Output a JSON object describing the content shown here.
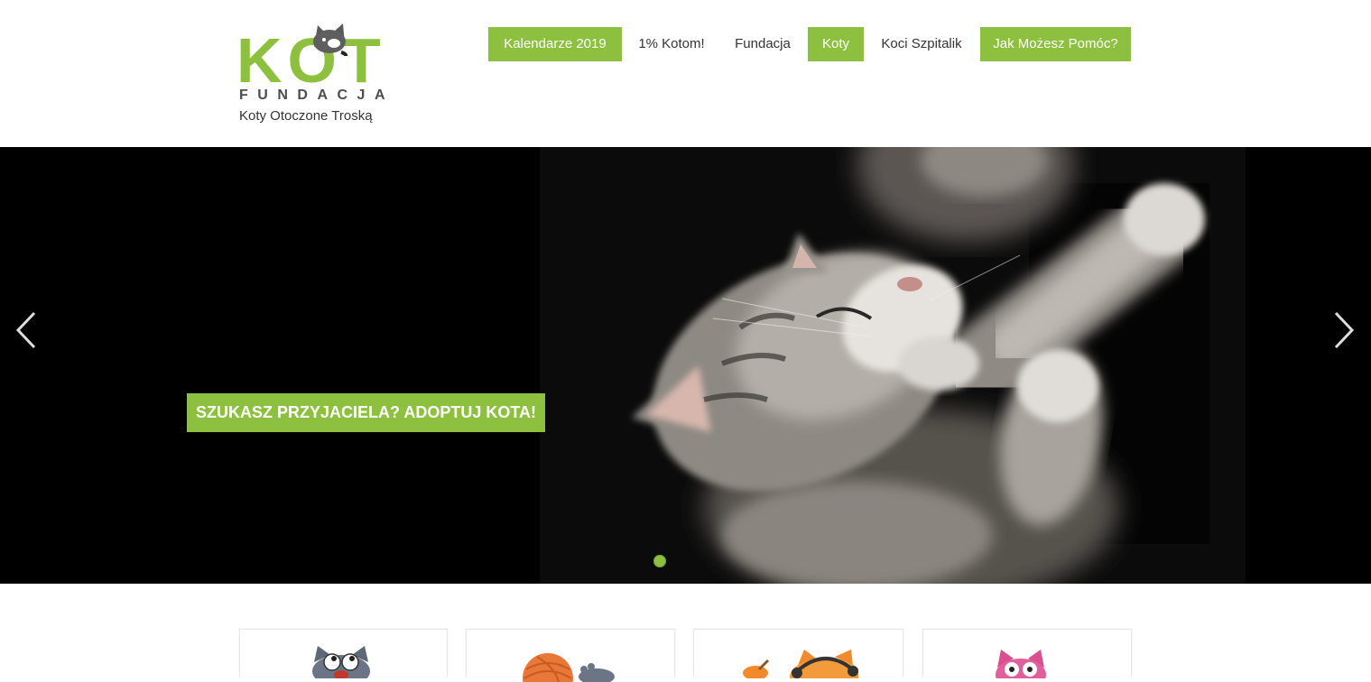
{
  "site": {
    "accent_color": "#8dc03f"
  },
  "logo": {
    "word": "KOT",
    "subword": "FUNDACJA",
    "tagline": "Koty Otoczone Troską",
    "icon": "cat-head-icon"
  },
  "nav": {
    "items": [
      {
        "label": "Kalendarze 2019",
        "highlighted": true
      },
      {
        "label": "1% Kotom!",
        "highlighted": false
      },
      {
        "label": "Fundacja",
        "highlighted": false
      },
      {
        "label": "Koty",
        "highlighted": true
      },
      {
        "label": "Koci Szpitalik",
        "highlighted": false
      },
      {
        "label": "Jak Możesz Pomóc?",
        "highlighted": true
      }
    ]
  },
  "hero": {
    "caption": "SZUKASZ PRZYJACIELA? ADOPTUJ KOTA!",
    "prev_icon": "chevron-left-icon",
    "next_icon": "chevron-right-icon",
    "indicator_icon": "slide-dot-icon"
  },
  "features": {
    "cards": [
      {
        "icon": "gray-cat-icon"
      },
      {
        "icon": "yarn-ball-icon"
      },
      {
        "icon": "orange-cat-icon"
      },
      {
        "icon": "pink-cat-icon"
      }
    ]
  }
}
